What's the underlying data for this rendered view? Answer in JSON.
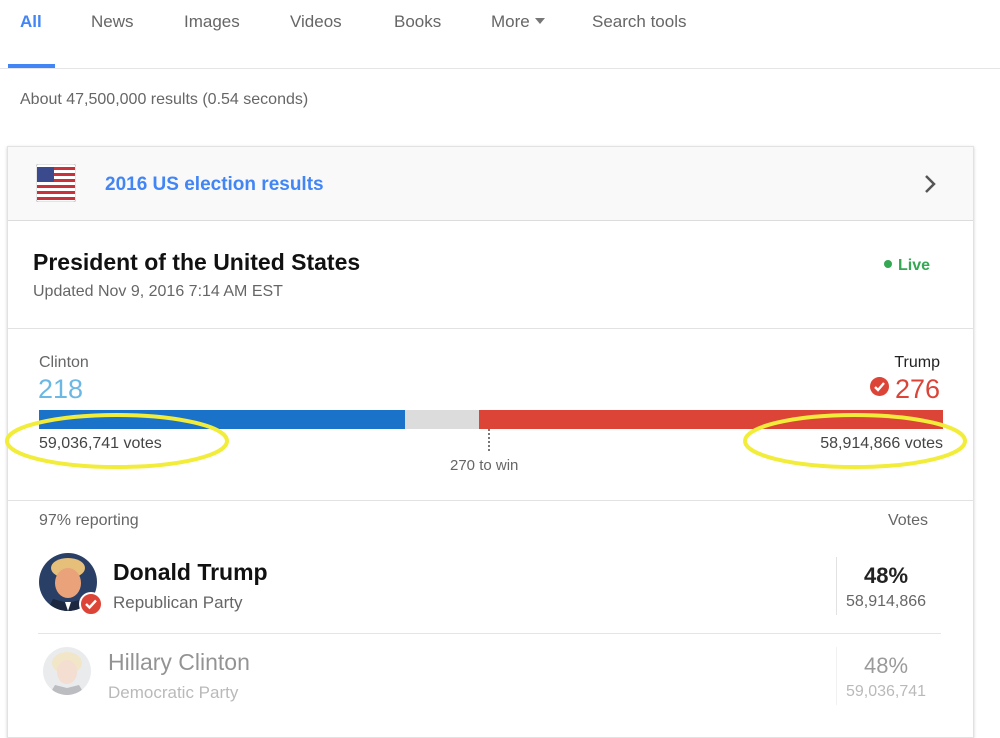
{
  "tabs": [
    {
      "label": "All",
      "active": true
    },
    {
      "label": "News"
    },
    {
      "label": "Images"
    },
    {
      "label": "Videos"
    },
    {
      "label": "Books"
    },
    {
      "label": "More"
    },
    {
      "label": "Search tools"
    }
  ],
  "result_stats": "About 47,500,000 results (0.54 seconds)",
  "card": {
    "title": "2016 US election results",
    "icon": "us-flag-icon",
    "office": "President of the United States",
    "updated": "Updated Nov 9, 2016 7:14 AM EST",
    "live_label": "Live",
    "live_color": "#34a853"
  },
  "race": {
    "clinton": {
      "name": "Clinton",
      "electoral_votes": "218",
      "popular_votes": "59,036,741 votes",
      "color": "#1a73c8",
      "ev_color": "#6bb8e4"
    },
    "trump": {
      "name": "Trump",
      "electoral_votes": "276",
      "popular_votes": "58,914,866 votes",
      "color": "#db4437",
      "winner": true
    },
    "to_win": "270 to win",
    "electoral_total": 538,
    "highlight_color": "#f2ec3a"
  },
  "table": {
    "reporting": "97% reporting",
    "votes_header": "Votes",
    "rows": [
      {
        "name": "Donald Trump",
        "party": "Republican Party",
        "percent": "48%",
        "votes": "58,914,866",
        "winner": true
      },
      {
        "name": "Hillary Clinton",
        "party": "Democratic Party",
        "percent": "48%",
        "votes": "59,036,741"
      }
    ]
  }
}
